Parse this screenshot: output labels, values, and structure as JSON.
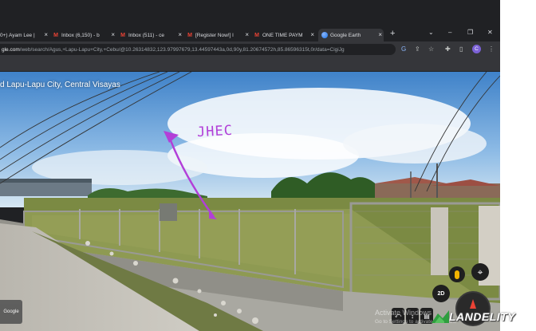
{
  "browser": {
    "tabs": [
      {
        "icon": "",
        "title": "0+) Ayam Lee |",
        "active": false
      },
      {
        "icon": "gmail-icon",
        "title": "Inbox (6,150) - b",
        "active": false
      },
      {
        "icon": "gmail-icon",
        "title": "Inbox (511) - ce",
        "active": false
      },
      {
        "icon": "gmail-icon",
        "title": "[Register Now!] l",
        "active": false
      },
      {
        "icon": "gmail-icon",
        "title": "ONE TIME PAYM",
        "active": false
      },
      {
        "icon": "google-earth-icon",
        "title": "Google Earth",
        "active": true
      }
    ],
    "close_glyph": "×",
    "new_tab_glyph": "+",
    "url_host": "gle.com",
    "url_path": "/web/search/Agus,+Lapu-Lapu+City,+Cebu/@10.26314832,123.97997679,13.44597443a,0d,90y,81.20674572h,85.86596315t,0r/data=CigiJg",
    "profile_initial": "C"
  },
  "streetview": {
    "location_title": "d Lapu-Lapu City, Central Visayas",
    "annotation": "JHEC",
    "google_label": "Google",
    "view_2d_label": "2D",
    "activate_windows": {
      "title": "Activate Windows",
      "subtitle": "Go to Settings to activate Windows."
    }
  },
  "watermark": {
    "text": "LANDELITY"
  },
  "colors": {
    "annotation": "#b23fd8",
    "tab_bar": "#202124",
    "toolbar": "#35363a",
    "gmail_red": "#ea4335"
  }
}
